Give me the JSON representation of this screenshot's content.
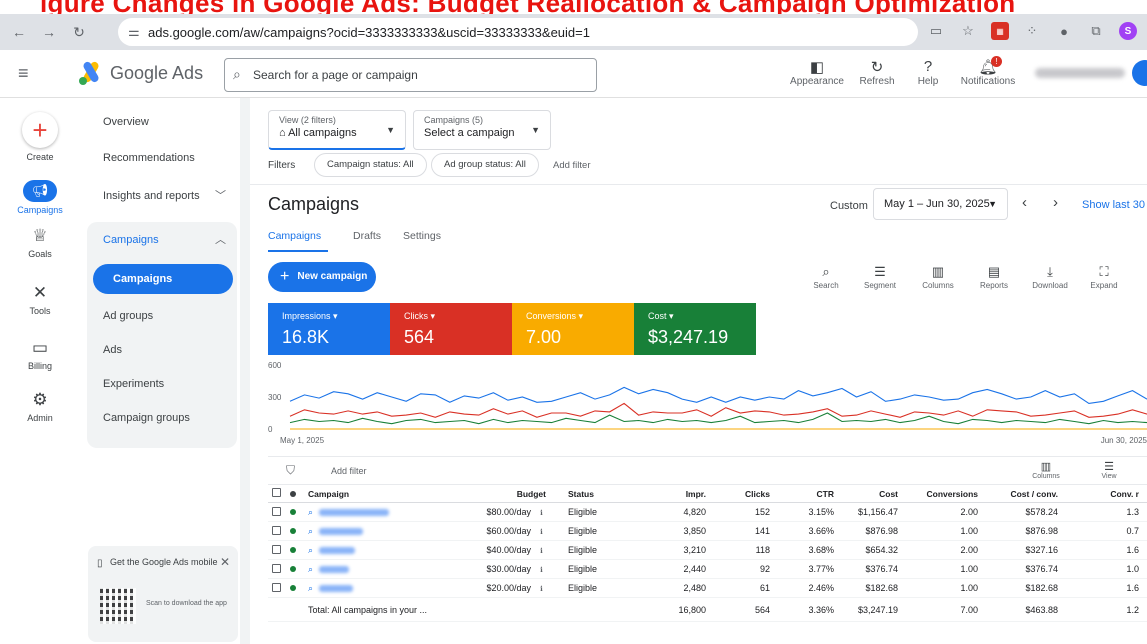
{
  "caption": "igure Changes in Google Ads: Budget Reallocation & Campaign Optimization",
  "browser": {
    "url": "ads.google.com/aw/campaigns?ocid=3333333333&uscid=33333333&euid=1",
    "icons": [
      "back-icon",
      "forward-icon",
      "reload-icon",
      "tune-icon"
    ]
  },
  "header": {
    "brand": "Google Ads",
    "search_placeholder": "Search for a page or campaign",
    "tools": [
      {
        "label": "Appearance",
        "icon": "appearance-icon"
      },
      {
        "label": "Refresh",
        "icon": "refresh-icon"
      },
      {
        "label": "Help",
        "icon": "help-icon"
      },
      {
        "label": "Notifications",
        "icon": "bell-icon",
        "badge": "!"
      }
    ],
    "colors": {
      "blue": "#1a73e8",
      "red": "#d93025",
      "yellow": "#f9ab00",
      "green": "#188038"
    }
  },
  "rail": [
    {
      "label": "Create",
      "icon": "plus-icon"
    },
    {
      "label": "Campaigns",
      "icon": "megaphone-icon",
      "active": true
    },
    {
      "label": "Goals",
      "icon": "trophy-icon"
    },
    {
      "label": "Tools",
      "icon": "tools-icon"
    },
    {
      "label": "Billing",
      "icon": "card-icon"
    },
    {
      "label": "Admin",
      "icon": "gear-icon"
    }
  ],
  "sidenav": {
    "items": [
      "Overview",
      "Recommendations",
      "Insights and reports",
      "Campaigns",
      "Campaigns",
      "Ad groups",
      "Ads",
      "Experiments",
      "Campaign groups"
    ],
    "mobile_title": "Get the Google Ads mobile",
    "mobile_scan": "Scan to download the app"
  },
  "filters": {
    "view_label": "View (2 filters)",
    "view_value": "All campaigns",
    "campaigns_label": "Campaigns (5)",
    "campaigns_value": "Select a campaign",
    "filters_label": "Filters",
    "chips": [
      "Campaign status: All",
      "Ad group status: All"
    ],
    "add_filter": "Add filter"
  },
  "page": {
    "title": "Campaigns",
    "custom": "Custom",
    "date_range": "May 1 – Jun 30, 2025",
    "show_last": "Show last 30 d",
    "tabs": [
      "Campaigns",
      "Drafts",
      "Settings"
    ],
    "new_campaign": "New campaign",
    "tools": [
      "Search",
      "Segment",
      "Columns",
      "Reports",
      "Download",
      "Expand"
    ]
  },
  "metrics": [
    {
      "label": "Impressions",
      "value": "16.8K",
      "color": "#1a73e8"
    },
    {
      "label": "Clicks",
      "value": "564",
      "color": "#d93025"
    },
    {
      "label": "Conversions",
      "value": "7.00",
      "color": "#f9ab00"
    },
    {
      "label": "Cost",
      "value": "$3,247.19",
      "color": "#188038"
    }
  ],
  "chart_data": {
    "type": "line",
    "y_ticks": [
      "600",
      "300",
      "0"
    ],
    "ylim": [
      0,
      600
    ],
    "x_start_label": "May 1, 2025",
    "x_end_label": "Jun 30, 2025",
    "series": [
      {
        "color": "#1a73e8",
        "values": [
          260,
          320,
          290,
          350,
          330,
          280,
          340,
          300,
          260,
          330,
          320,
          250,
          310,
          290,
          340,
          270,
          300,
          250,
          260,
          300,
          340,
          280,
          320,
          390,
          330,
          370,
          340,
          280,
          250,
          300,
          250,
          300,
          270,
          300,
          280,
          360,
          310,
          340,
          380,
          300,
          350,
          260,
          280,
          320,
          300,
          270,
          280,
          340,
          370,
          330,
          280,
          300,
          360,
          300,
          330,
          240,
          260,
          310,
          360,
          280
        ]
      },
      {
        "color": "#d93025",
        "values": [
          120,
          180,
          150,
          140,
          170,
          140,
          160,
          120,
          130,
          150,
          110,
          160,
          140,
          130,
          190,
          140,
          170,
          110,
          150,
          150,
          120,
          170,
          160,
          240,
          130,
          160,
          150,
          150,
          180,
          120,
          200,
          150,
          170,
          160,
          130,
          140,
          160,
          190,
          120,
          130,
          170,
          140,
          110,
          160,
          150,
          130,
          170,
          120,
          180,
          170,
          160,
          120,
          130,
          150,
          170,
          110,
          120,
          140,
          180,
          140
        ]
      },
      {
        "color": "#f9ab00",
        "values": [
          0,
          0,
          0,
          0,
          0,
          0,
          0,
          0,
          0,
          0,
          0,
          0,
          0,
          0,
          0,
          0,
          0,
          0,
          0,
          0,
          0,
          0,
          0,
          0,
          0,
          0,
          0,
          0,
          0,
          0,
          0,
          0,
          0,
          0,
          0,
          0,
          0,
          0,
          0,
          0,
          0,
          0,
          0,
          0,
          0,
          0,
          0,
          0,
          0,
          0,
          0,
          0,
          0,
          0,
          0,
          0,
          0,
          0,
          0,
          0
        ]
      },
      {
        "color": "#188038",
        "values": [
          60,
          90,
          70,
          80,
          60,
          100,
          70,
          50,
          80,
          90,
          60,
          70,
          80,
          50,
          90,
          60,
          80,
          70,
          60,
          100,
          80,
          60,
          130,
          70,
          80,
          60,
          90,
          70,
          80,
          60,
          80,
          120,
          60,
          70,
          80,
          60,
          90,
          150,
          70,
          80,
          70,
          90,
          60,
          80,
          120,
          70,
          50,
          90,
          80,
          60,
          80,
          70,
          60,
          90,
          70,
          50,
          80,
          60,
          70,
          60
        ]
      }
    ]
  },
  "table": {
    "add_filter": "Add filter",
    "columns_label": "Columns",
    "view_label": "View",
    "headers": [
      "Campaign",
      "Budget",
      "Status",
      "Impr.",
      "Clicks",
      "CTR",
      "Cost",
      "Conversions",
      "Cost / conv.",
      "Conv. r"
    ],
    "rows": [
      {
        "budget": "$80.00/day",
        "status": "Eligible",
        "impr": "4,820",
        "clicks": "152",
        "ctr": "3.15%",
        "cost": "$1,156.47",
        "conv": "2.00",
        "cpc": "$578.24",
        "rate": "1.3"
      },
      {
        "budget": "$60.00/day",
        "status": "Eligible",
        "impr": "3,850",
        "clicks": "141",
        "ctr": "3.66%",
        "cost": "$876.98",
        "conv": "1.00",
        "cpc": "$876.98",
        "rate": "0.7"
      },
      {
        "budget": "$40.00/day",
        "status": "Eligible",
        "impr": "3,210",
        "clicks": "118",
        "ctr": "3.68%",
        "cost": "$654.32",
        "conv": "2.00",
        "cpc": "$327.16",
        "rate": "1.6"
      },
      {
        "budget": "$30.00/day",
        "status": "Eligible",
        "impr": "2,440",
        "clicks": "92",
        "ctr": "3.77%",
        "cost": "$376.74",
        "conv": "1.00",
        "cpc": "$376.74",
        "rate": "1.0"
      },
      {
        "budget": "$20.00/day",
        "status": "Eligible",
        "impr": "2,480",
        "clicks": "61",
        "ctr": "2.46%",
        "cost": "$182.68",
        "conv": "1.00",
        "cpc": "$182.68",
        "rate": "1.6"
      }
    ],
    "total": {
      "label": "Total: All campaigns in your ...",
      "impr": "16,800",
      "clicks": "564",
      "ctr": "3.36%",
      "cost": "$3,247.19",
      "conv": "7.00",
      "cpc": "$463.88",
      "rate": "1.2"
    }
  }
}
